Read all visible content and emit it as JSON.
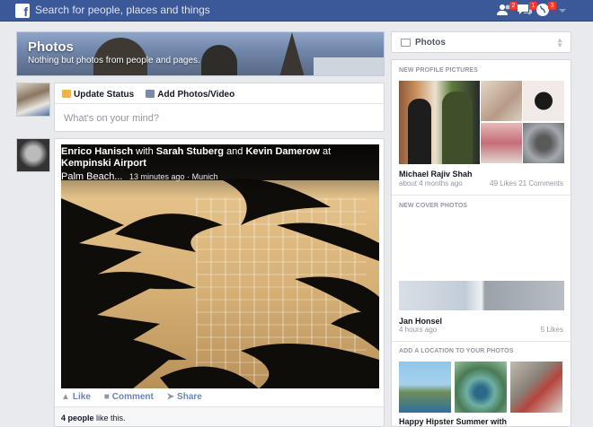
{
  "topbar": {
    "logo": "f",
    "search_placeholder": "Search for people, places and things",
    "friend_requests_count": "2",
    "messages_count": "1",
    "notifications_count": "3",
    "color": "#3b5998"
  },
  "cover": {
    "title": "Photos",
    "subtitle": "Nothing but photos from people and pages."
  },
  "composer": {
    "update_status": "Update Status",
    "add_photo": "Add Photos/Video",
    "placeholder": "What's on your mind?"
  },
  "post": {
    "author": "Enrico Hanisch",
    "with_word": "with",
    "tag1": "Sarah Stuberg",
    "and_word": "and",
    "tag2": "Kevin Damerow",
    "at_word": "at",
    "place": "Kempinski Airport",
    "place_line": "Palm Beach...",
    "time": "13 minutes ago",
    "sep": "·",
    "city": "Munich",
    "like": "Like",
    "comment": "Comment",
    "share": "Share",
    "likes_count": "4 people",
    "likes_suffix": "like this."
  },
  "right": {
    "header_label": "Photos",
    "new_profile_title": "NEW PROFILE PICTURES",
    "profile_name": "Michael Rajiv Shah",
    "profile_time": "about 4 months ago",
    "profile_stats": "49 Likes 21 Comments",
    "new_cover_title": "NEW COVER PHOTOS",
    "cover_name": "Jan Honsel",
    "cover_time": "4 hours ago",
    "cover_likes": "5 Likes",
    "location_title": "ADD A LOCATION TO YOUR PHOTOS",
    "location_caption": "Happy Hipster Summer with"
  },
  "icons": {
    "logo": "facebook-logo-icon",
    "friends": "friend-requests-icon",
    "messages": "messages-icon",
    "notifications": "notifications-globe-icon",
    "like": "thumbs-up-icon",
    "comment": "comment-icon",
    "share": "share-arrow-icon"
  }
}
